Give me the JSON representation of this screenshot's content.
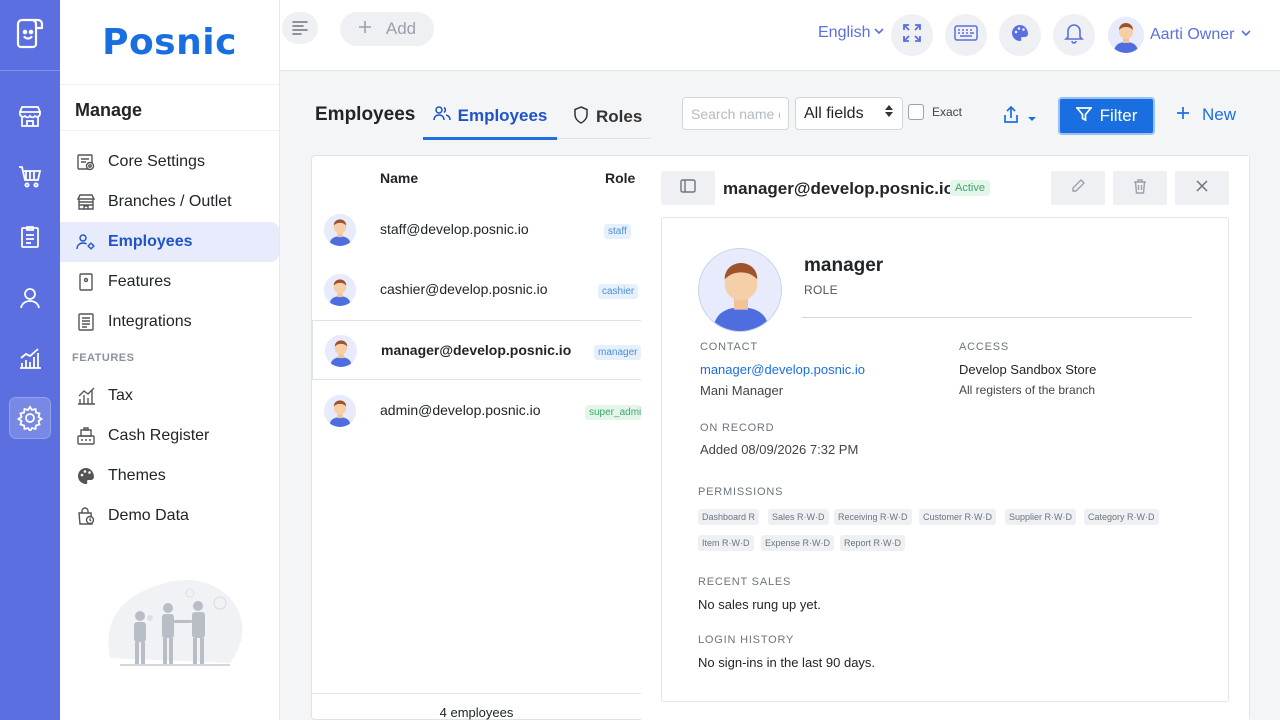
{
  "app": {
    "brand": "Posnic"
  },
  "topbar": {
    "add_label": "Add",
    "language": "English",
    "user_name": "Aarti Owner"
  },
  "sidebar": {
    "manage_title": "Manage",
    "items": [
      {
        "label": "Core Settings"
      },
      {
        "label": "Branches / Outlet"
      },
      {
        "label": "Employees"
      },
      {
        "label": "Features"
      },
      {
        "label": "Integrations"
      }
    ],
    "features_heading": "FEATURES",
    "feature_items": [
      {
        "label": "Tax"
      },
      {
        "label": "Cash Register"
      },
      {
        "label": "Themes"
      },
      {
        "label": "Demo Data"
      }
    ]
  },
  "page": {
    "title": "Employees",
    "tabs": [
      {
        "label": "Employees"
      },
      {
        "label": "Roles"
      }
    ],
    "search_placeholder": "Search name or email",
    "fields_select": "All fields",
    "exact_label": "Exact",
    "filter_label": "Filter",
    "new_label": "New"
  },
  "list": {
    "columns": {
      "name": "Name",
      "role": "Role"
    },
    "rows": [
      {
        "name": "staff@develop.posnic.io",
        "role": "staff"
      },
      {
        "name": "cashier@develop.posnic.io",
        "role": "cashier"
      },
      {
        "name": "manager@develop.posnic.io",
        "role": "manager"
      },
      {
        "name": "admin@develop.posnic.io",
        "role": "super_admin"
      }
    ],
    "count_label": "4 employees"
  },
  "detail": {
    "title": "manager@develop.posnic.io",
    "status": "Active",
    "name": "manager",
    "role_label": "ROLE",
    "contact_heading": "CONTACT",
    "email": "manager@develop.posnic.io",
    "full_name": "Mani Manager",
    "access_heading": "ACCESS",
    "store": "Develop Sandbox Store",
    "registers": "All registers of the branch",
    "on_record_heading": "ON RECORD",
    "added": "Added 08/09/2026 7:32 PM",
    "permissions_heading": "PERMISSIONS",
    "permissions": [
      "Dashboard R",
      "Sales R·W·D",
      "Receiving R·W·D",
      "Customer R·W·D",
      "Supplier R·W·D",
      "Category R·W·D",
      "Item R·W·D",
      "Expense R·W·D",
      "Report R·W·D"
    ],
    "recent_sales_heading": "RECENT SALES",
    "recent_sales": "No sales rung up yet.",
    "login_history_heading": "LOGIN HISTORY",
    "login_history": "No sign-ins in the last 90 days."
  },
  "colors": {
    "rail": "#5b6fe0",
    "primary": "#1a6fe0",
    "active_badge": "#3ba86a"
  }
}
